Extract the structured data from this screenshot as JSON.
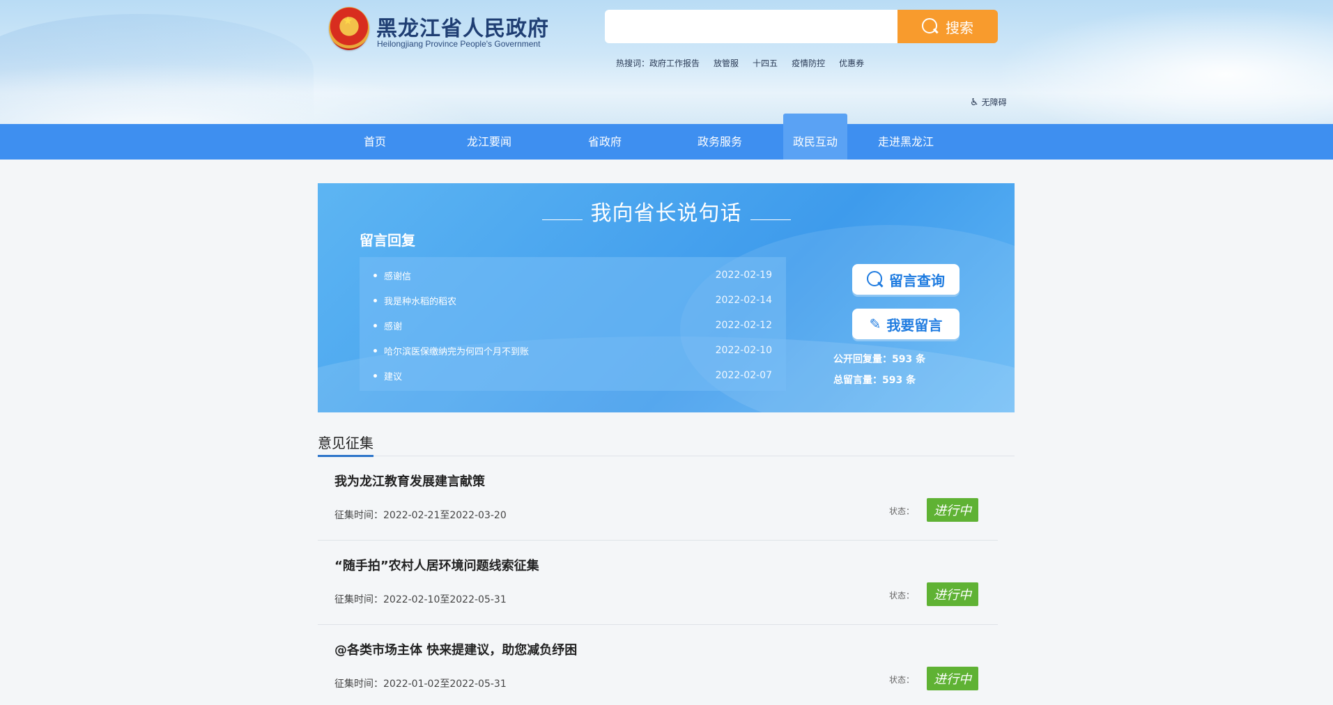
{
  "header": {
    "site_title": "黑龙江省人民政府",
    "site_subtitle": "Heilongjiang Province People's Government",
    "search": {
      "placeholder": "",
      "value": "",
      "button_label": "搜索"
    },
    "hotwords_label": "热搜词：",
    "hotwords": [
      "政府工作报告",
      "放管服",
      "十四五",
      "疫情防控",
      "优惠券"
    ],
    "accessibility_label": "无障碍"
  },
  "nav": {
    "items": [
      {
        "label": "首页"
      },
      {
        "label": "龙江要闻"
      },
      {
        "label": "省政府"
      },
      {
        "label": "政务服务"
      },
      {
        "label": "政民互动"
      },
      {
        "label": "走进黑龙江"
      }
    ],
    "active": "政民互动"
  },
  "banner": {
    "title": "我向省长说句话",
    "subtitle": "留言回复",
    "messages": [
      {
        "title": "感谢信",
        "date": "2022-02-19"
      },
      {
        "title": "我是种水稻的稻农",
        "date": "2022-02-14"
      },
      {
        "title": "感谢",
        "date": "2022-02-12"
      },
      {
        "title": "哈尔滨医保缴纳完为何四个月不到账",
        "date": "2022-02-10"
      },
      {
        "title": "建议",
        "date": "2022-02-07"
      }
    ],
    "query_button": "留言查询",
    "post_button": "我要留言",
    "public_reply": "公开回复量：593 条",
    "total_messages": "总留言量：593 条"
  },
  "collection": {
    "section_title": "意见征集",
    "status_label": "状态：",
    "items": [
      {
        "title": "我为龙江教育发展建言献策",
        "time": "征集时间：2022-02-21至2022-03-20",
        "status": "进行中"
      },
      {
        "title": "“随手拍”农村人居环境问题线索征集",
        "time": "征集时间：2022-02-10至2022-05-31",
        "status": "进行中"
      },
      {
        "title": "@各类市场主体 快来提建议，助您减负纾困",
        "time": "征集时间：2022-01-02至2022-05-31",
        "status": "进行中"
      }
    ]
  },
  "colors": {
    "nav_bg": "#3e8ff0",
    "search_button": "#f89b2d",
    "status_green": "#5fb234",
    "section_accent": "#2a73c9"
  }
}
